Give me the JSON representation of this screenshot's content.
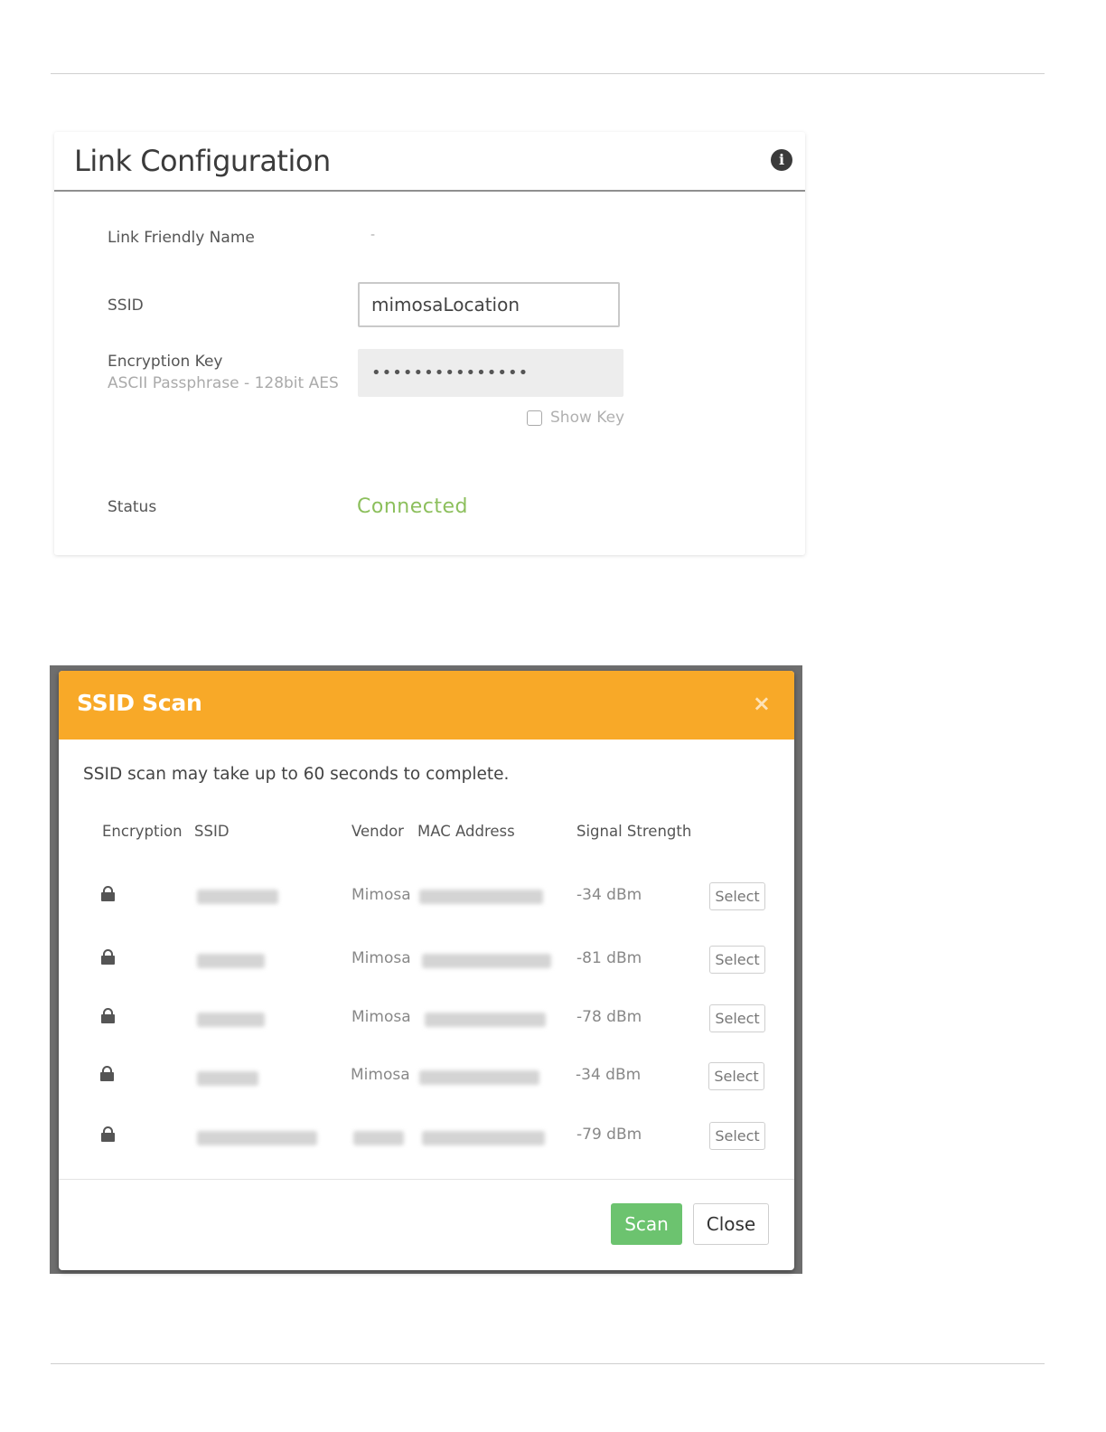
{
  "link_config": {
    "title": "Link Configuration",
    "friendly_name_label": "Link Friendly Name",
    "friendly_name_value": "-",
    "ssid_label": "SSID",
    "ssid_value": "mimosaLocation",
    "encryption_label": "Encryption Key",
    "encryption_sub": "ASCII Passphrase - 128bit AES",
    "encryption_value": "•••••••••••••••",
    "show_key_label": "Show Key",
    "status_label": "Status",
    "status_value": "Connected",
    "info_icon": "info-icon",
    "status_color": "#8cbf5c"
  },
  "ssid_scan": {
    "title": "SSID Scan",
    "close_icon": "×",
    "note": "SSID scan may take up to 60 seconds to complete.",
    "columns": {
      "encryption": "Encryption",
      "ssid": "SSID",
      "vendor": "Vendor",
      "mac": "MAC Address",
      "signal": "Signal Strength"
    },
    "rows": [
      {
        "vendor": "Mimosa",
        "signal": "-34 dBm",
        "action": "Select"
      },
      {
        "vendor": "Mimosa",
        "signal": "-81 dBm",
        "action": "Select"
      },
      {
        "vendor": "Mimosa",
        "signal": "-78 dBm",
        "action": "Select"
      },
      {
        "vendor": "Mimosa",
        "signal": "-34 dBm",
        "action": "Select"
      },
      {
        "vendor": "",
        "signal": "-79 dBm",
        "action": "Select"
      }
    ],
    "scan_label": "Scan",
    "close_label": "Close",
    "header_color": "#f8a928",
    "scan_color": "#6cc36f"
  }
}
